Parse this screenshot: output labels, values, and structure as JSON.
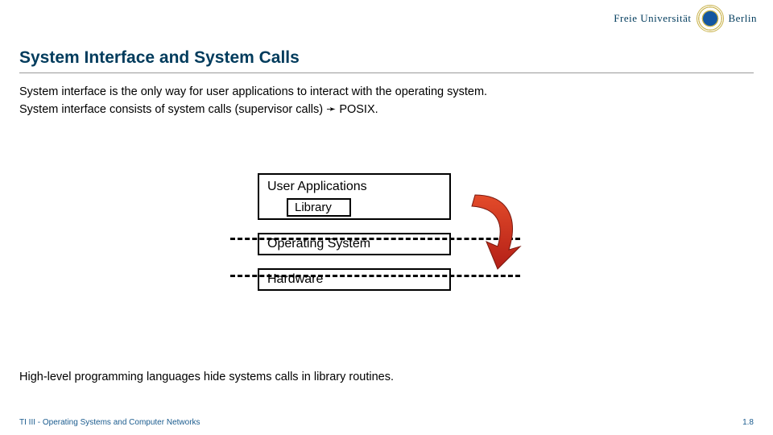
{
  "logo": {
    "left": "Freie Universität",
    "right": "Berlin"
  },
  "title": "System Interface and System Calls",
  "intro": {
    "line1": "System interface is the only way for user applications to interact with the operating system.",
    "line2": "System interface consists of system calls (supervisor calls) ➛ POSIX."
  },
  "diagram": {
    "user_applications": "User Applications",
    "library": "Library",
    "operating_system": "Operating System",
    "hardware": "Hardware"
  },
  "conclusion": "High-level programming languages hide systems calls in library routines.",
  "footer": {
    "course": "TI III - Operating Systems and Computer Networks",
    "page": "1.8"
  }
}
